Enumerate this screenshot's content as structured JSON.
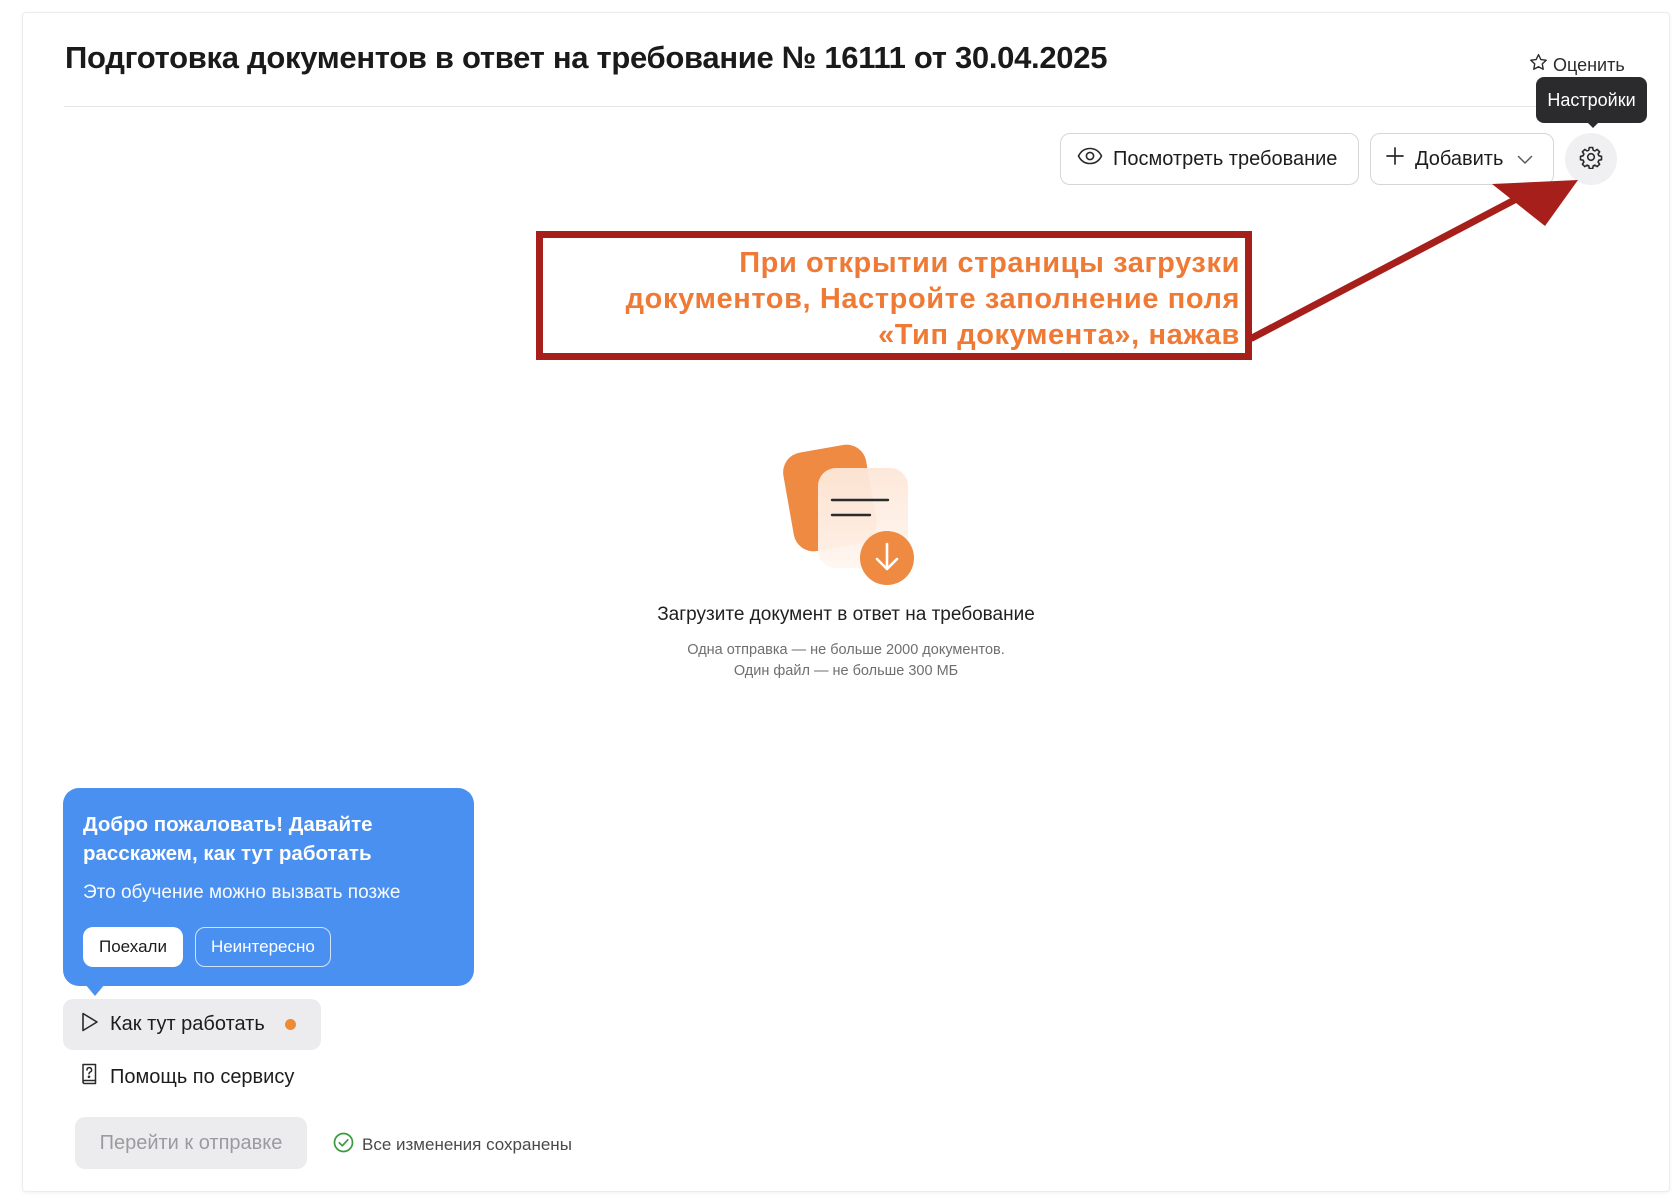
{
  "header": {
    "title": "Подготовка документов в ответ на требование № 16111 от 30.04.2025",
    "rate_label": "Оценить"
  },
  "toolbar": {
    "view_requirement_label": "Посмотреть требование",
    "add_label": "Добавить",
    "settings_tooltip": "Настройки"
  },
  "annotation": {
    "line1": "При открытии страницы загрузки",
    "line2": "документов,  Настройте заполнение поля",
    "line3": "«Тип документа», нажав",
    "color": "#ef7a35",
    "frame_color": "#a61f1a"
  },
  "upload": {
    "title": "Загрузите документ в ответ на требование",
    "hint_1": "Одна отправка — не больше 2000 документов.",
    "hint_2": "Один файл — не больше 300 МБ"
  },
  "onboarding": {
    "title": "Добро пожаловать! Давайте расскажем, как тут работать",
    "subtitle": "Это обучение можно вызвать позже",
    "go_label": "Поехали",
    "skip_label": "Неинтересно",
    "bg_color": "#4a90f0"
  },
  "footer": {
    "how_it_works_label": "Как тут работать",
    "help_label": "Помощь по сервису",
    "submit_label": "Перейти к отправке",
    "saved_status": "Все изменения сохранены"
  },
  "icons": {
    "rate": "star-icon",
    "view": "eye-icon",
    "add": "plus-icon",
    "dropdown": "chevron-down-icon",
    "settings": "gear-icon",
    "play": "play-icon",
    "help": "question-book-icon",
    "saved": "check-circle-icon"
  }
}
